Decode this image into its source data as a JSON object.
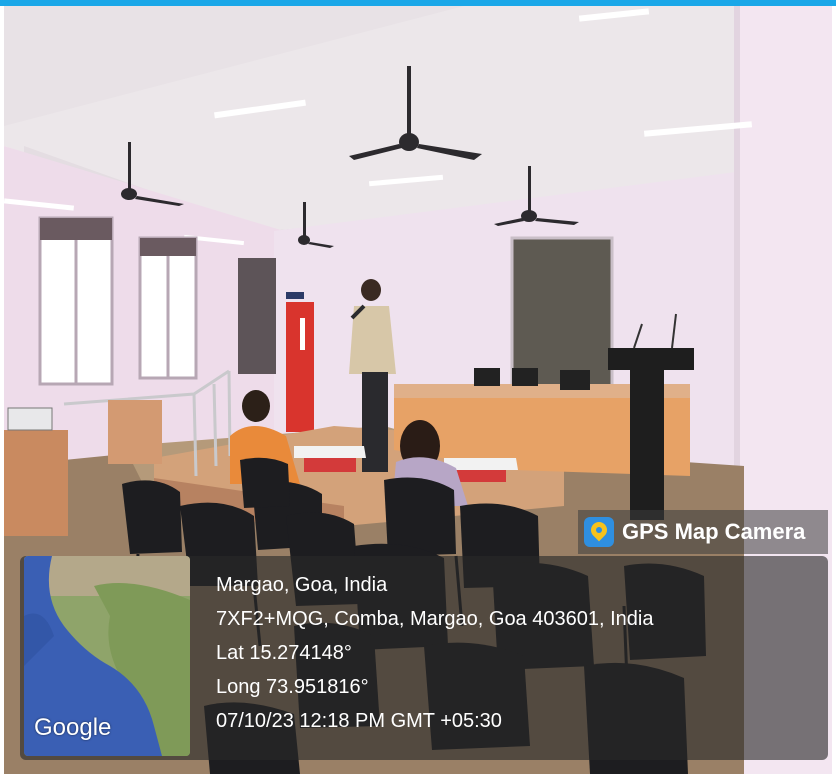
{
  "badge": {
    "app_name": "GPS Map Camera",
    "icon": "gps-map-camera-logo"
  },
  "location": {
    "title": "Margao, Goa, India",
    "address": "7XF2+MQG, Comba, Margao, Goa 403601, India",
    "lat": "Lat 15.274148°",
    "long": "Long 73.951816°",
    "timestamp": "07/10/23 12:18 PM GMT +05:30"
  },
  "map": {
    "provider": "Google"
  },
  "colors": {
    "top_bar": "#1aa7e8",
    "overlay": "#282828"
  }
}
